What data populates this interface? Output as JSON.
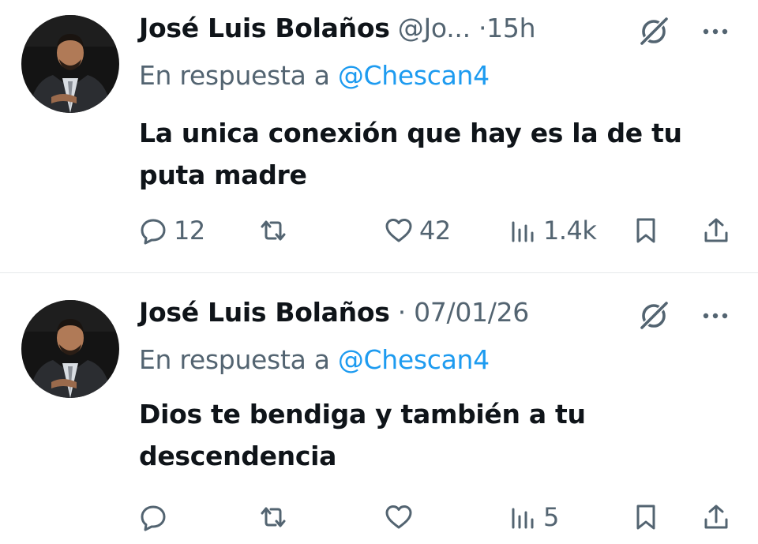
{
  "tweets": [
    {
      "author_name": "José Luis Bolaños",
      "handle": "@Jo...",
      "separator": "·",
      "time": "15h",
      "reply_prefix": "En respuesta a",
      "reply_mention": "@Chescan4",
      "text": "La unica conexión que hay es la de tu puta madre",
      "replies": "12",
      "retweets": "",
      "likes": "42",
      "views": "1.4k",
      "icons": {
        "grok": "grok-icon",
        "more": "more-icon",
        "reply": "reply-icon",
        "retweet": "retweet-icon",
        "like": "heart-icon",
        "views": "views-chart-icon",
        "bookmark": "bookmark-icon",
        "share": "share-icon"
      }
    },
    {
      "author_name": "José Luis Bolaños",
      "handle": "",
      "separator": "·",
      "time": "07/01/26",
      "reply_prefix": "En respuesta a",
      "reply_mention": "@Chescan4",
      "text": "Dios te bendiga y también a tu descendencia",
      "replies": "",
      "retweets": "",
      "likes": "",
      "views": "5",
      "icons": {
        "grok": "grok-icon",
        "more": "more-icon",
        "reply": "reply-icon",
        "retweet": "retweet-icon",
        "like": "heart-icon",
        "views": "views-chart-icon",
        "bookmark": "bookmark-icon",
        "share": "share-icon"
      }
    }
  ],
  "colors": {
    "text_primary": "#0f1419",
    "text_secondary": "#536471",
    "mention": "#1d9bf0",
    "divider": "#e6e9eb"
  }
}
